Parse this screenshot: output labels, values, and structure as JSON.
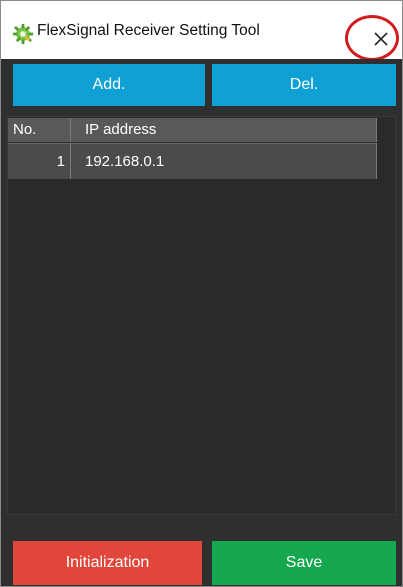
{
  "window": {
    "title": "FlexSignal Receiver Setting Tool",
    "close_symbol": "×"
  },
  "toolbar": {
    "add_label": "Add.",
    "del_label": "Del."
  },
  "table": {
    "columns": [
      "No.",
      "IP address"
    ],
    "rows": [
      {
        "no": "1",
        "ip": "192.168.0.1"
      }
    ]
  },
  "footer": {
    "init_label": "Initialization",
    "save_label": "Save"
  },
  "colors": {
    "accent_blue": "#0fa1d3",
    "init_red": "#e0473a",
    "save_green": "#15a84f",
    "panel_dark": "#2f2f2f",
    "highlight_ring": "#d21d1d"
  },
  "icons": {
    "app_icon": "gear-puzzle-icon",
    "close_icon": "close-icon"
  }
}
